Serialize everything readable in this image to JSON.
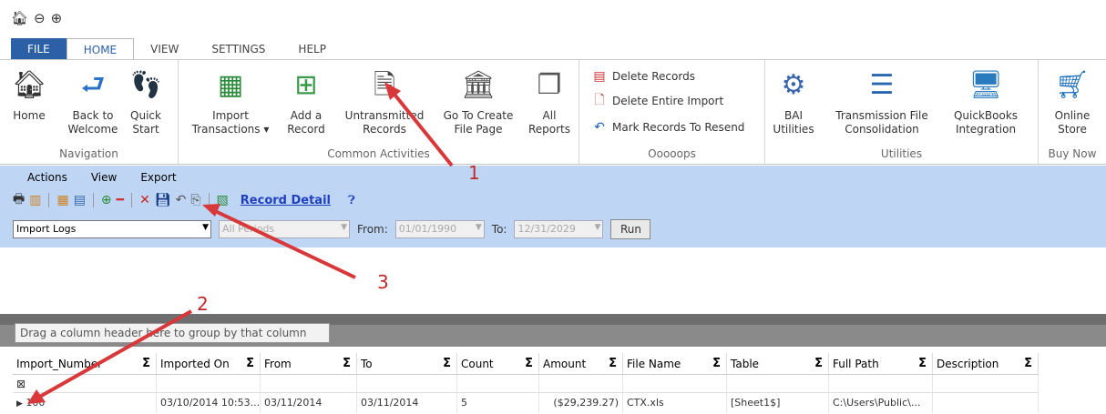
{
  "quick_access": {
    "home_icon": "home-icon",
    "back_icon": "back-circle-icon",
    "forward_icon": "forward-circle-icon"
  },
  "tabs": [
    "FILE",
    "HOME",
    "VIEW",
    "SETTINGS",
    "HELP"
  ],
  "ribbon": {
    "navigation": {
      "label": "Navigation",
      "home": "Home",
      "back": "Back to\nWelcome",
      "quick": "Quick\nStart"
    },
    "common": {
      "label": "Common Activities",
      "import": "Import\nTransactions ▾",
      "add": "Add a\nRecord",
      "untransmitted": "Untransmitted\nRecords",
      "goto": "Go To Create\nFile Page",
      "reports": "All\nReports"
    },
    "ooops": {
      "label": "Ooooops",
      "delete_records": "Delete Records",
      "delete_import": "Delete Entire Import",
      "mark_resend": "Mark Records To Resend"
    },
    "utilities": {
      "label": "Utilities",
      "bai": "BAI\nUtilities",
      "transmission": "Transmission File\nConsolidation",
      "quickbooks": "QuickBooks\nIntegration"
    },
    "buy": {
      "label": "Buy Now",
      "store": "Online\nStore"
    }
  },
  "menu": {
    "actions": "Actions",
    "view": "View",
    "export": "Export"
  },
  "toolbar": {
    "record_detail": "Record Detail"
  },
  "filter": {
    "log_select": "Import Logs",
    "period_select": "All Periods",
    "from_label": "From:",
    "from_value": "01/01/1990",
    "to_label": "To:",
    "to_value": "12/31/2029",
    "run": "Run"
  },
  "group_hint": "Drag a column header here to group by that column",
  "columns": [
    "Import_Number",
    "Imported On",
    "From",
    "To",
    "Count",
    "Amount",
    "File Name",
    "Table",
    "Full Path",
    "Description"
  ],
  "rows": [
    {
      "import_number": "100",
      "imported_on": "03/10/2014 10:53...",
      "from": "03/11/2014",
      "to": "03/11/2014",
      "count": "5",
      "amount": "($29,239.27)",
      "file_name": "CTX.xls",
      "table": "[Sheet1$]",
      "full_path": "C:\\Users\\Public\\...",
      "description": ""
    }
  ],
  "callouts": {
    "c1": "1",
    "c2": "2",
    "c3": "3"
  },
  "colors": {
    "file_tab": "#2b5fa6",
    "bluebar": "#bed6f4",
    "arrow": "#d9383a"
  }
}
